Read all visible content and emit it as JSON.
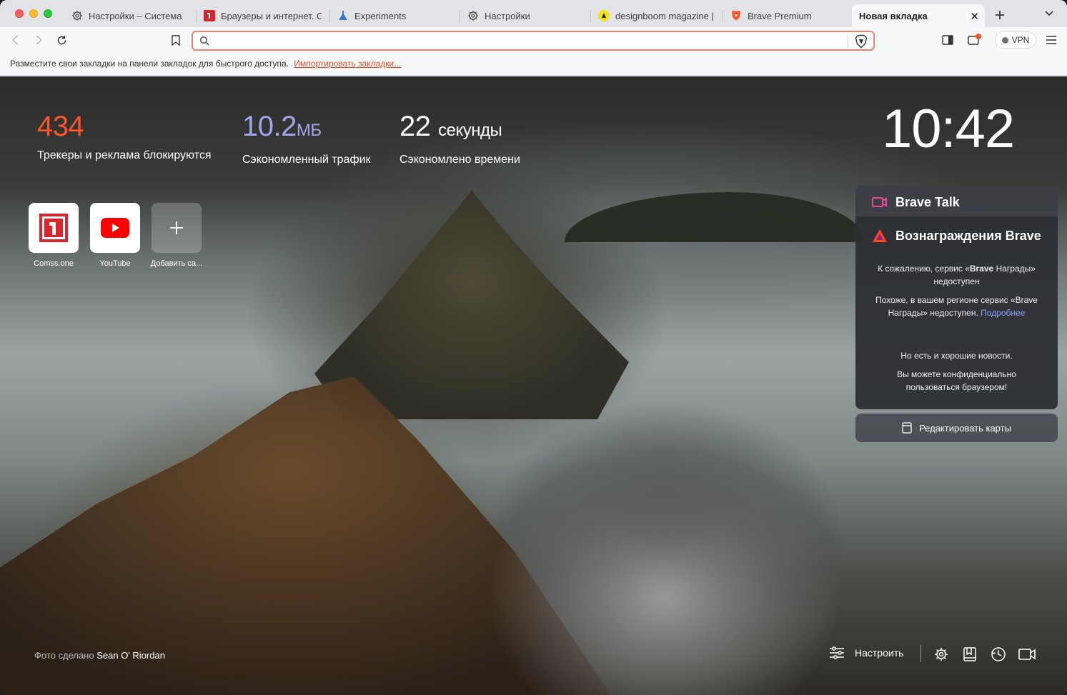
{
  "tabs": [
    {
      "label": "Настройки – Система",
      "icon": "gear-icon"
    },
    {
      "label": "Браузеры и интернет. Сс",
      "icon": "comss-icon"
    },
    {
      "label": "Experiments",
      "icon": "flask-icon"
    },
    {
      "label": "Настройки",
      "icon": "gear-icon"
    },
    {
      "label": "designboom magazine | y",
      "icon": "designboom-icon"
    },
    {
      "label": "Brave Premium",
      "icon": "brave-lion-icon"
    },
    {
      "label": "Новая вкладка",
      "icon": "none",
      "active": true
    }
  ],
  "toolbar": {
    "url_value": "",
    "url_placeholder": "",
    "vpn_label": "VPN"
  },
  "bookmarks_bar": {
    "message": "Разместите свои закладки на панели закладок для быстрого доступа.",
    "import_link": "Импортировать закладки..."
  },
  "stats": {
    "trackers_count": "434",
    "trackers_caption": "Трекеры и реклама блокируются",
    "bandwidth_value": "10.2",
    "bandwidth_unit": "МБ",
    "bandwidth_caption": "Сэкономленный трафик",
    "time_value": "22",
    "time_unit": "секунды",
    "time_caption": "Сэкономлено времени"
  },
  "clock": "10:42",
  "top_sites": [
    {
      "name": "Comss.one",
      "icon": "comss-icon"
    },
    {
      "name": "YouTube",
      "icon": "youtube-icon"
    },
    {
      "name": "Добавить са...",
      "icon": "plus-icon"
    }
  ],
  "cards": {
    "talk_title": "Brave Talk",
    "rewards_title": "Вознаграждения Brave",
    "rewards_msg1_pre": "К сожалению, сервис «",
    "rewards_msg1_bold": "Brave",
    "rewards_msg1_post": " Награды» недоступен",
    "rewards_msg2": "Похоже, в вашем регионе сервис «Brave Награды» недоступен.",
    "rewards_msg2_link": "Подробнее",
    "rewards_msg3": "Но есть и хорошие новости.",
    "rewards_msg4": "Вы можете конфиденциально пользоваться браузером!",
    "edit_cards_label": "Редактировать карты"
  },
  "footer": {
    "photo_prefix": "Фото сделано",
    "photo_author": "Sean O' Riordan",
    "customize_label": "Настроить"
  },
  "colors": {
    "brave_orange": "#fb542b",
    "bandwidth_purple": "#a0a5eb",
    "url_focus_border": "#f1816b",
    "link_blue": "#8aa4ff"
  }
}
